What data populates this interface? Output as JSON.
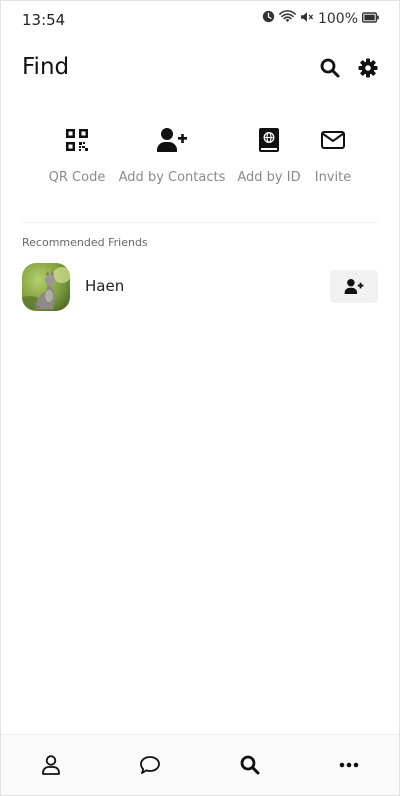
{
  "status_bar": {
    "time": "13:54",
    "battery_percent": "100%",
    "icons": [
      "clock-icon",
      "wifi-icon",
      "mute-icon",
      "battery-icon"
    ]
  },
  "header": {
    "title": "Find",
    "icons": [
      "search-icon",
      "gear-icon"
    ]
  },
  "quick_actions": [
    {
      "label": "QR Code",
      "icon": "qr-code-icon"
    },
    {
      "label": "Add by Contacts",
      "icon": "add-contact-icon"
    },
    {
      "label": "Add by ID",
      "icon": "id-book-icon"
    },
    {
      "label": "Invite",
      "icon": "envelope-icon"
    }
  ],
  "recommended": {
    "section_title": "Recommended Friends",
    "friends": [
      {
        "name": "Haen",
        "avatar": "cat-photo",
        "action_icon": "add-user-icon"
      }
    ]
  },
  "bottom_nav": {
    "tabs": [
      {
        "icon": "person-icon",
        "active": false
      },
      {
        "icon": "chat-bubble-icon",
        "active": false
      },
      {
        "icon": "search-icon",
        "active": true
      },
      {
        "icon": "more-icon",
        "active": false
      }
    ]
  }
}
